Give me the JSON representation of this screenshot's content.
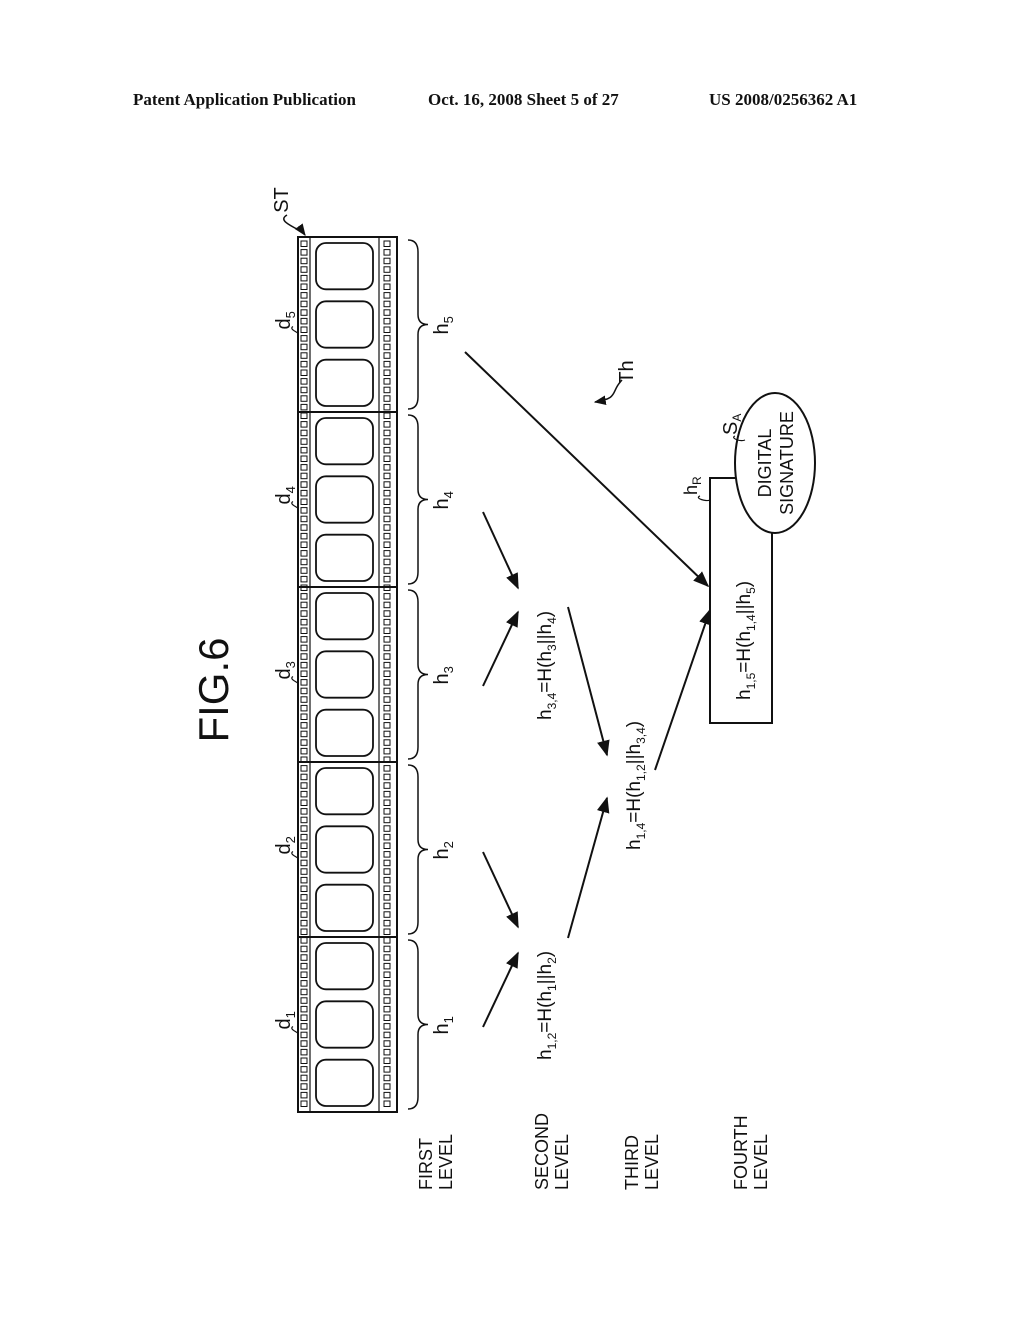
{
  "header": {
    "publication": "Patent Application Publication",
    "date_sheet": "Oct. 16, 2008   Sheet 5 of 27",
    "number": "US 2008/0256362 A1"
  },
  "figure": {
    "title": "FIG.6",
    "stream_label": "ST",
    "tree_label": "Th",
    "segments": [
      {
        "data_label": "d",
        "data_sub": "1",
        "hash_label": "h",
        "hash_sub": "1",
        "frames": 3
      },
      {
        "data_label": "d",
        "data_sub": "2",
        "hash_label": "h",
        "hash_sub": "2",
        "frames": 3
      },
      {
        "data_label": "d",
        "data_sub": "3",
        "hash_label": "h",
        "hash_sub": "3",
        "frames": 3
      },
      {
        "data_label": "d",
        "data_sub": "4",
        "hash_label": "h",
        "hash_sub": "4",
        "frames": 3
      },
      {
        "data_label": "d",
        "data_sub": "5",
        "hash_label": "h",
        "hash_sub": "5",
        "frames": 3
      }
    ],
    "levels": [
      "FIRST LEVEL",
      "SECOND LEVEL",
      "THIRD LEVEL",
      "FOURTH LEVEL"
    ],
    "level_lines": [
      [
        "FIRST",
        "LEVEL"
      ],
      [
        "SECOND",
        "LEVEL"
      ],
      [
        "THIRD",
        "LEVEL"
      ],
      [
        "FOURTH",
        "LEVEL"
      ]
    ],
    "formulas": {
      "h12": "h1,2=H(h1||h2)",
      "h34": "h3,4=H(h3||h4)",
      "h14": "h1,4=H(h1,2||h3,4)",
      "h15": "h1,5=H(h1,4||h5)"
    },
    "root_label": "h",
    "root_sub": "R",
    "signature_label": "S",
    "signature_sub": "A",
    "signature_lines": [
      "DIGITAL",
      "SIGNATURE"
    ]
  }
}
